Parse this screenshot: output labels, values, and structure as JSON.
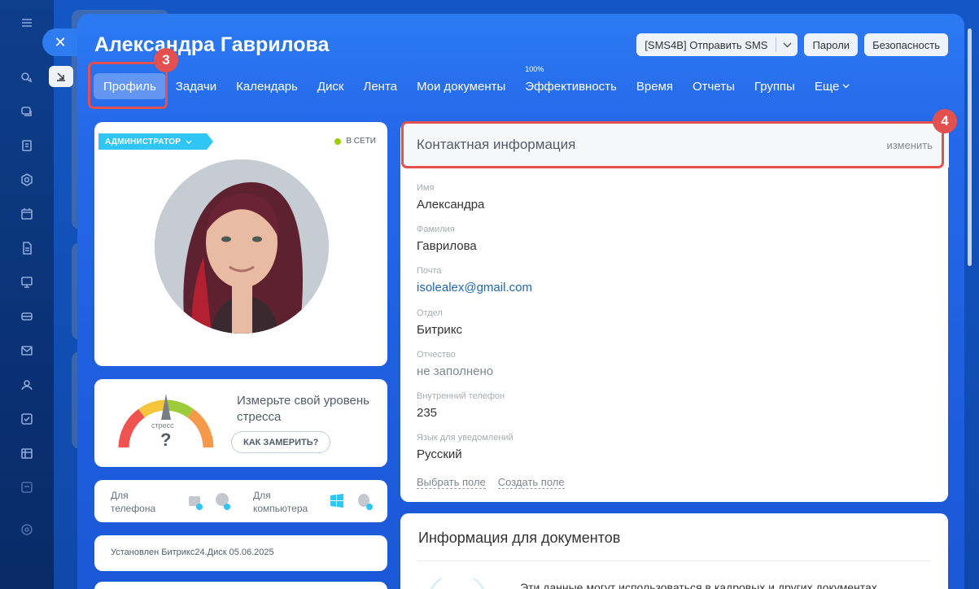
{
  "user": {
    "name": "Александра Гаврилова"
  },
  "actions": {
    "sms_label": "[SMS4B] Отправить SMS",
    "passwords_label": "Пароли",
    "security_label": "Безопасность"
  },
  "tabs": [
    {
      "label": "Профиль"
    },
    {
      "label": "Задачи"
    },
    {
      "label": "Календарь"
    },
    {
      "label": "Диск"
    },
    {
      "label": "Лента"
    },
    {
      "label": "Мои документы"
    },
    {
      "label": "Эффективность",
      "badge": "100%"
    },
    {
      "label": "Время"
    },
    {
      "label": "Отчеты"
    },
    {
      "label": "Группы"
    },
    {
      "label": "Еще"
    }
  ],
  "annotations": {
    "step3": "3",
    "step4": "4"
  },
  "profile_card": {
    "role": "АДМИНИСТРАТОР",
    "status": "В СЕТИ"
  },
  "stress": {
    "gauge_label": "стресс",
    "gauge_value": "?",
    "text": "Измерьте свой уровень стресса",
    "button": "КАК ЗАМЕРИТЬ?"
  },
  "apps": {
    "phone_label": "Для телефона",
    "computer_label": "Для компьютера"
  },
  "disk": {
    "installed_text": "Установлен Битрикс24.Диск 05.06.2025"
  },
  "contact": {
    "title": "Контактная информация",
    "edit": "изменить",
    "fields": [
      {
        "label": "Имя",
        "value": "Александра"
      },
      {
        "label": "Фамилия",
        "value": "Гаврилова"
      },
      {
        "label": "Почта",
        "value": "isolealex@gmail.com"
      },
      {
        "label": "Отдел",
        "value": "Битрикс"
      },
      {
        "label": "Отчество",
        "value": "не заполнено"
      },
      {
        "label": "Внутренний телефон",
        "value": "235"
      },
      {
        "label": "Язык для уведомлений",
        "value": "Русский"
      }
    ],
    "choose_field": "Выбрать поле",
    "create_field": "Создать поле"
  },
  "documents": {
    "title": "Информация для документов",
    "text": "Эти данные могут использоваться в кадровых и других документах"
  },
  "colors": {
    "accent": "#2fc6f6",
    "highlight": "#e2514f",
    "online": "#9dcf00",
    "link": "#2067b0"
  }
}
